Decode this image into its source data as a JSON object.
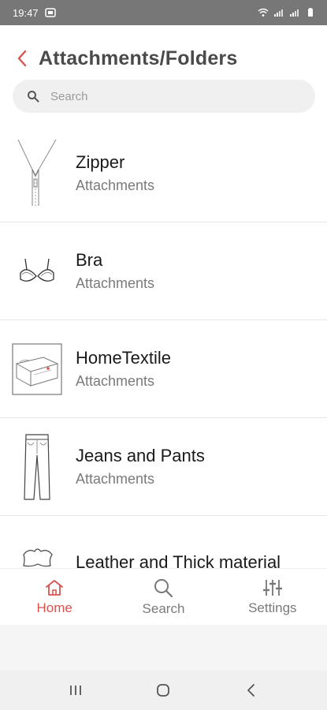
{
  "status_bar": {
    "time": "19:47"
  },
  "header": {
    "title": "Attachments/Folders",
    "search_placeholder": "Search"
  },
  "items": [
    {
      "title": "Zipper",
      "subtitle": "Attachments",
      "icon": "zipper-icon"
    },
    {
      "title": "Bra",
      "subtitle": "Attachments",
      "icon": "bra-icon"
    },
    {
      "title": "HomeTextile",
      "subtitle": "Attachments",
      "icon": "bed-icon"
    },
    {
      "title": "Jeans and Pants",
      "subtitle": "Attachments",
      "icon": "jeans-icon"
    },
    {
      "title": "Leather and Thick material",
      "subtitle": "",
      "icon": "leather-icon"
    }
  ],
  "bottom_nav": {
    "home": "Home",
    "search": "Search",
    "settings": "Settings"
  },
  "colors": {
    "accent": "#d9534f",
    "muted": "#7a7a7a"
  }
}
